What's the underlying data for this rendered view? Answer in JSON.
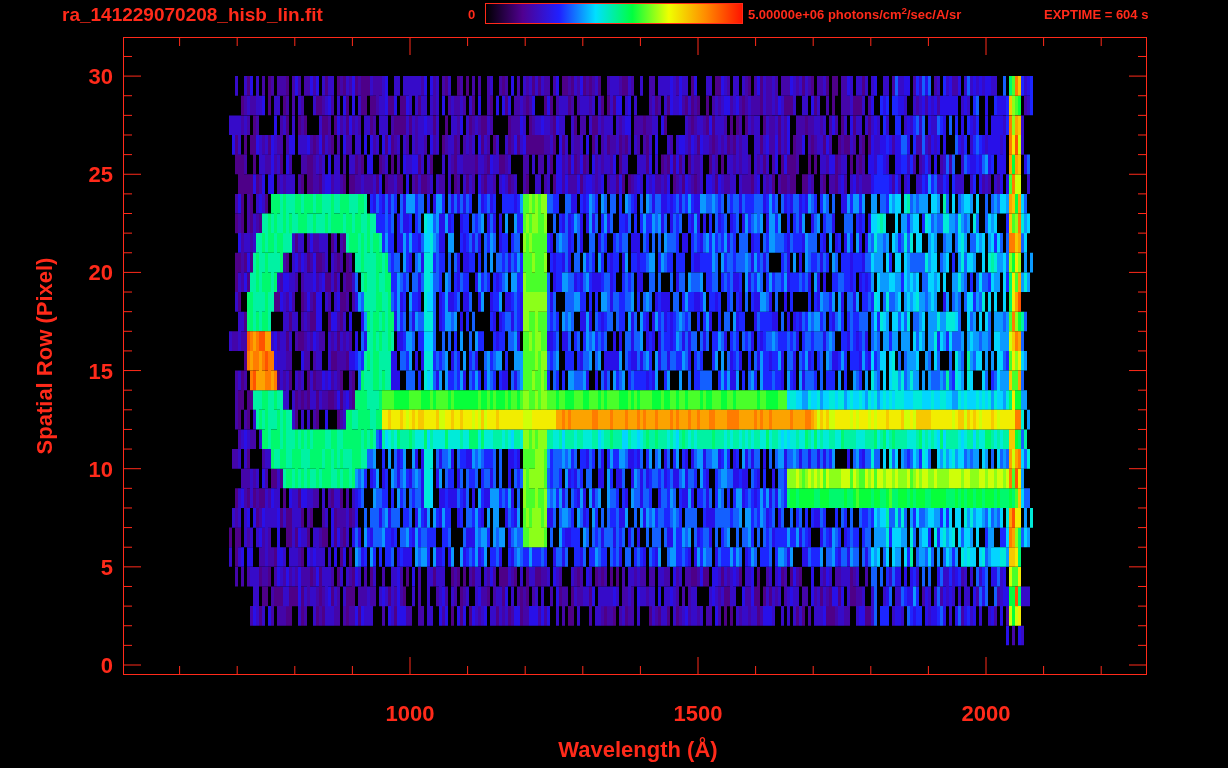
{
  "title": "ra_141229070208_hisb_lin.fit",
  "colorbar": {
    "min_label": "0",
    "max_label": "5.00000e+06 photons/cm$^{2}$/sec/A/sr"
  },
  "exposure": "EXPTIME = 604 s",
  "y_axis": {
    "label": "Spatial Row (Pixel)",
    "ticks": [
      "30",
      "25",
      "20",
      "15",
      "10",
      "5",
      "0"
    ]
  },
  "x_axis": {
    "label": "Wavelength (Å)",
    "ticks": [
      "1000",
      "1500",
      "2000"
    ]
  }
}
